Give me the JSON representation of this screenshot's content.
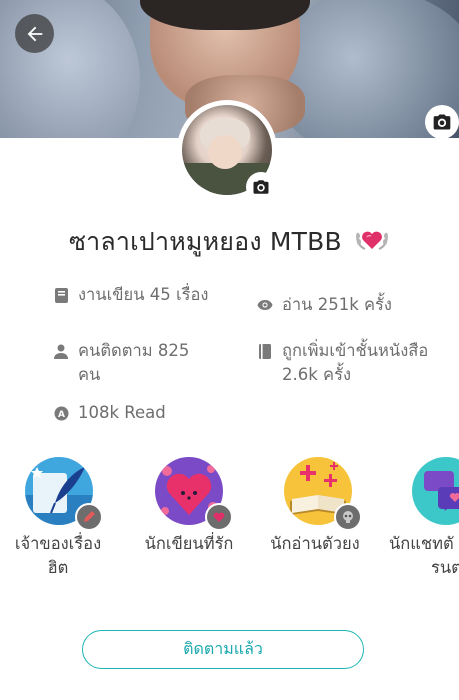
{
  "profile": {
    "name": "ซาลาเปาหมูหยอง MTBB",
    "name_badge_icon": "heart-laurel-icon"
  },
  "stats": {
    "works": "งานเขียน 45 เรื่อง",
    "reads": "อ่าน 251k ครั้ง",
    "followers": "คนติดตาม 825 คน",
    "library_adds": "ถูกเพิ่มเข้าชั้นหนังสือ 2.6k ครั้ง",
    "read_count": "108k Read"
  },
  "badges": [
    {
      "label_line1": "เจ้าของเรื่อง",
      "label_line2": "ฮิต",
      "icon": "quill-icon"
    },
    {
      "label_line1": "นักเขียนที่รัก",
      "icon": "heart-face-icon"
    },
    {
      "label_line1": "นักอ่านตัวยง",
      "icon": "open-book-icon"
    },
    {
      "label_line1": "นักแชทตั",
      "label_line2": "รนต",
      "icon": "chat-bubble-icon"
    }
  ],
  "actions": {
    "follow_label": "ติดตามแล้ว"
  },
  "colors": {
    "accent": "#1aa8ad",
    "heart": "#e0306a"
  }
}
